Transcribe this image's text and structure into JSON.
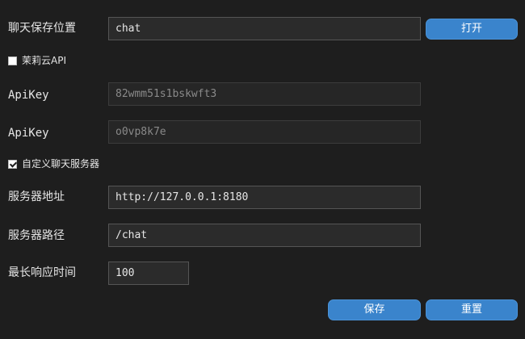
{
  "chat_save": {
    "label": "聊天保存位置",
    "value": "chat",
    "open_button": "打开"
  },
  "jasmine_cloud": {
    "checkbox_label": "茉莉云API",
    "checked": false,
    "apikey1_label": "ApiKey",
    "apikey1_value": "82wmm51s1bskwft3",
    "apikey2_label": "ApiKey",
    "apikey2_value": "o0vp8k7e"
  },
  "custom_server": {
    "checkbox_label": "自定义聊天服务器",
    "checked": true,
    "address_label": "服务器地址",
    "address_value": "http://127.0.0.1:8180",
    "path_label": "服务器路径",
    "path_value": "/chat",
    "timeout_label": "最长响应时间",
    "timeout_value": "100"
  },
  "actions": {
    "save": "保存",
    "reset": "重置"
  },
  "colors": {
    "background": "#1e1e1e",
    "button": "#3a84cc",
    "input_bg": "#2b2b2b"
  }
}
